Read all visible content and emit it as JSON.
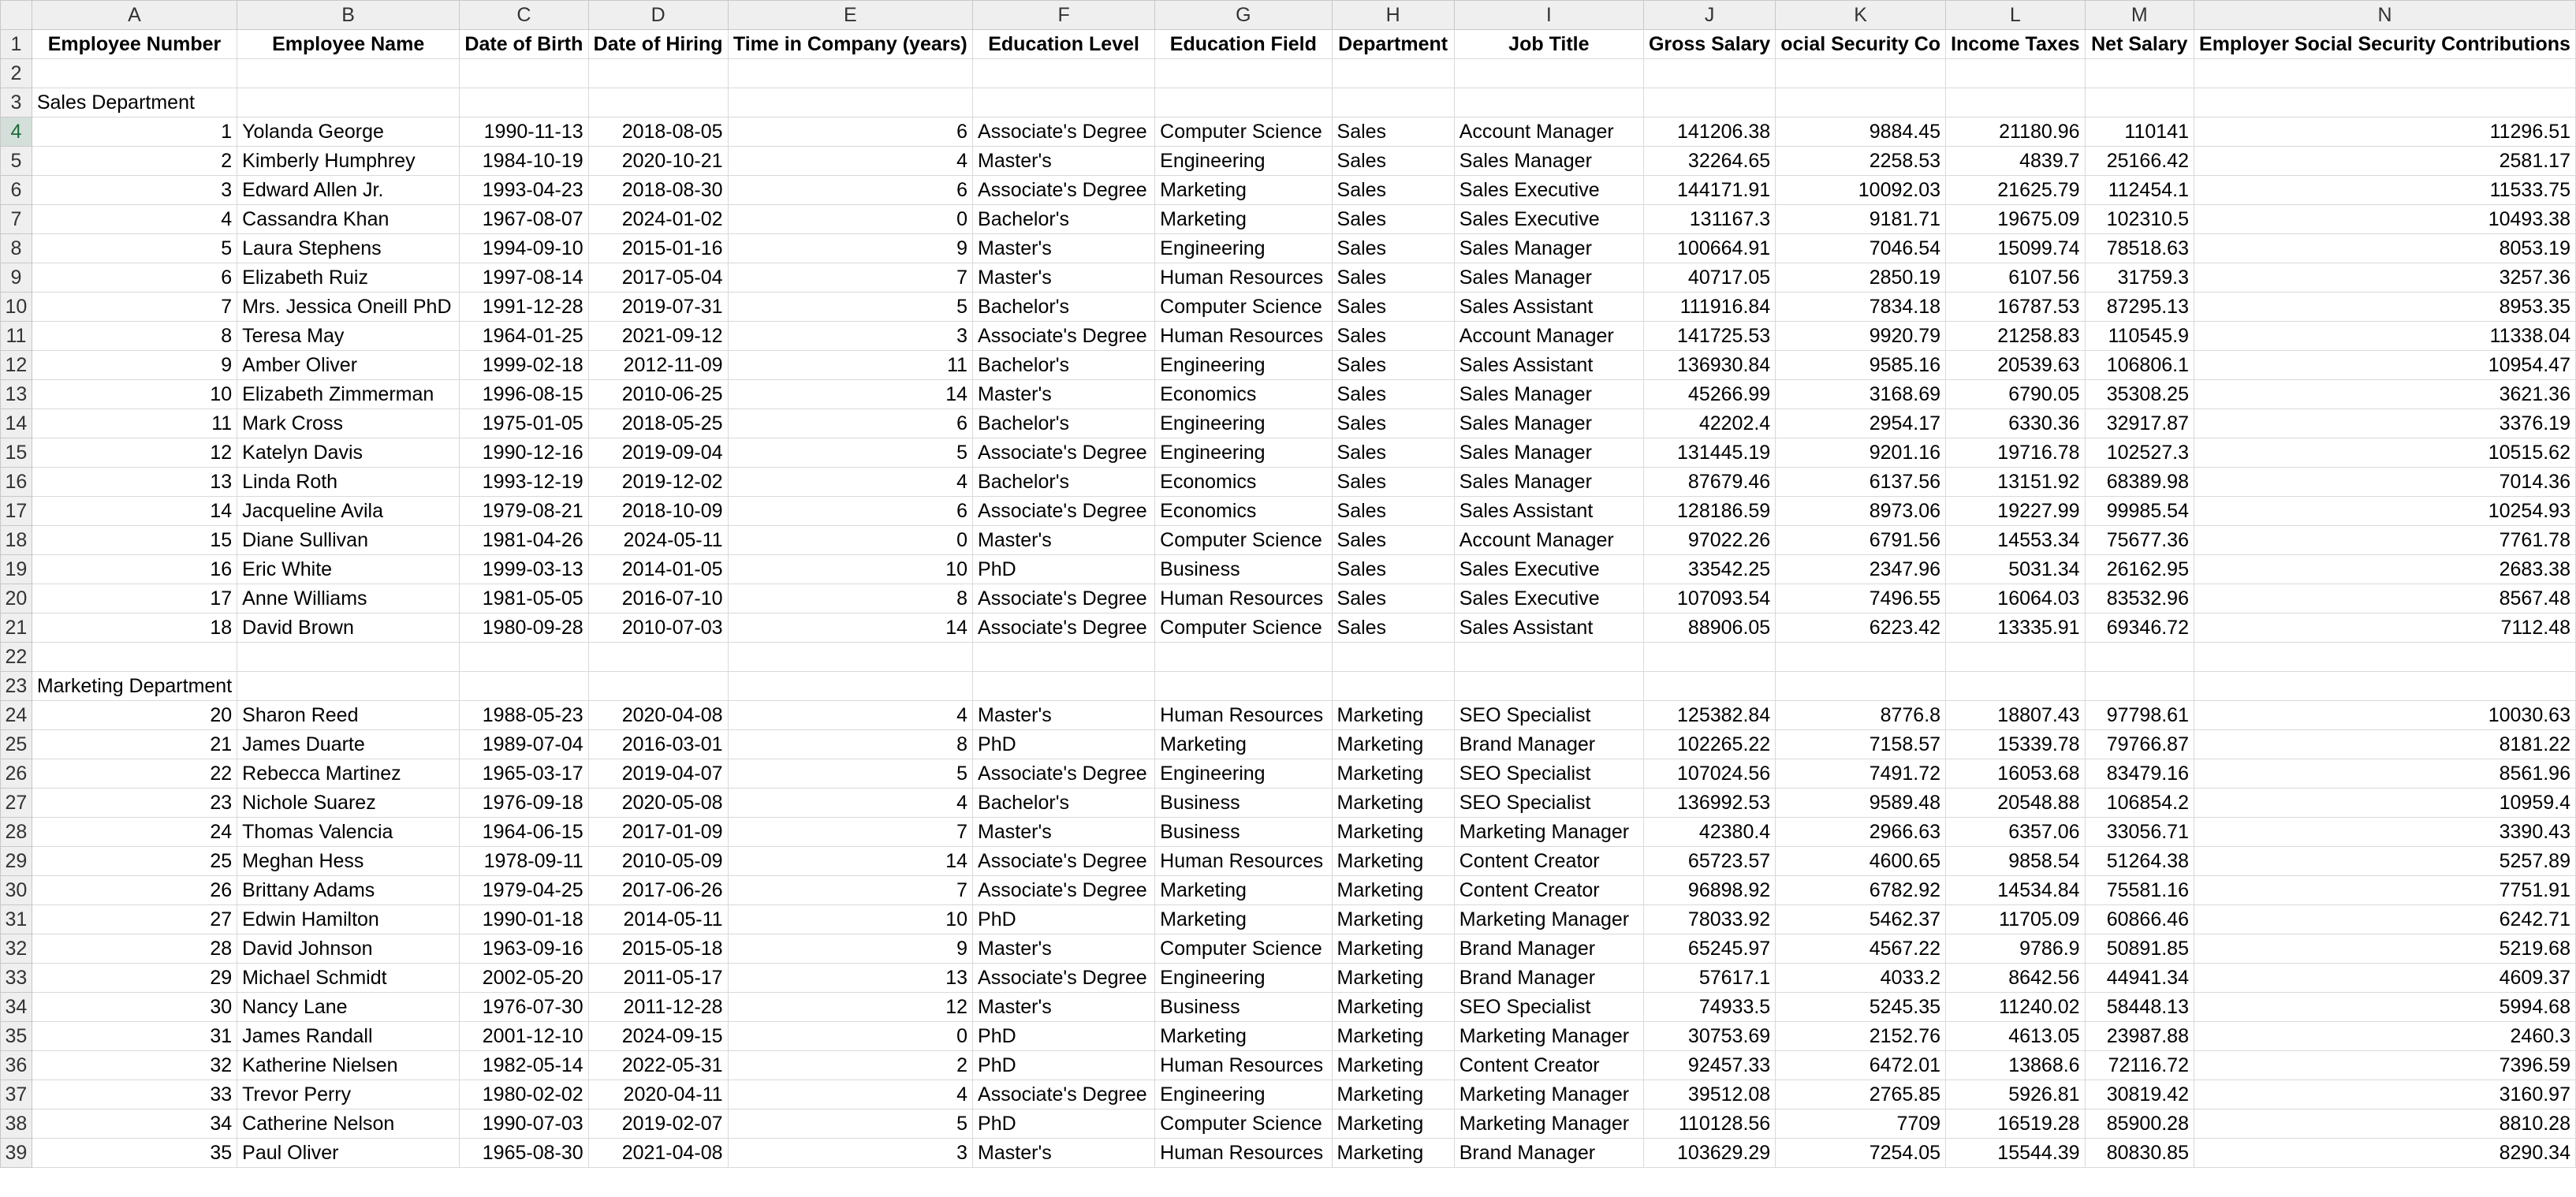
{
  "columns": [
    "A",
    "B",
    "C",
    "D",
    "E",
    "F",
    "G",
    "H",
    "I",
    "J",
    "K",
    "L",
    "M",
    "N"
  ],
  "headers": [
    "Employee Number",
    "Employee Name",
    "Date of Birth",
    "Date of Hiring",
    "Time in Company (years)",
    "Education Level",
    "Education Field",
    "Department",
    "Job Title",
    "Gross Salary",
    "ocial Security Co",
    "Income Taxes",
    "Net Salary",
    "Employer Social Security Contributions"
  ],
  "sections": {
    "sales": "Sales Department",
    "marketing": "Marketing Department"
  },
  "sales_rows": [
    [
      "1",
      "Yolanda George",
      "1990-11-13",
      "2018-08-05",
      "6",
      "Associate's Degree",
      "Computer Science",
      "Sales",
      "Account Manager",
      "141206.38",
      "9884.45",
      "21180.96",
      "110141",
      "11296.51"
    ],
    [
      "2",
      "Kimberly Humphrey",
      "1984-10-19",
      "2020-10-21",
      "4",
      "Master's",
      "Engineering",
      "Sales",
      "Sales Manager",
      "32264.65",
      "2258.53",
      "4839.7",
      "25166.42",
      "2581.17"
    ],
    [
      "3",
      "Edward Allen Jr.",
      "1993-04-23",
      "2018-08-30",
      "6",
      "Associate's Degree",
      "Marketing",
      "Sales",
      "Sales Executive",
      "144171.91",
      "10092.03",
      "21625.79",
      "112454.1",
      "11533.75"
    ],
    [
      "4",
      "Cassandra Khan",
      "1967-08-07",
      "2024-01-02",
      "0",
      "Bachelor's",
      "Marketing",
      "Sales",
      "Sales Executive",
      "131167.3",
      "9181.71",
      "19675.09",
      "102310.5",
      "10493.38"
    ],
    [
      "5",
      "Laura Stephens",
      "1994-09-10",
      "2015-01-16",
      "9",
      "Master's",
      "Engineering",
      "Sales",
      "Sales Manager",
      "100664.91",
      "7046.54",
      "15099.74",
      "78518.63",
      "8053.19"
    ],
    [
      "6",
      "Elizabeth Ruiz",
      "1997-08-14",
      "2017-05-04",
      "7",
      "Master's",
      "Human Resources",
      "Sales",
      "Sales Manager",
      "40717.05",
      "2850.19",
      "6107.56",
      "31759.3",
      "3257.36"
    ],
    [
      "7",
      "Mrs. Jessica Oneill PhD",
      "1991-12-28",
      "2019-07-31",
      "5",
      "Bachelor's",
      "Computer Science",
      "Sales",
      "Sales Assistant",
      "111916.84",
      "7834.18",
      "16787.53",
      "87295.13",
      "8953.35"
    ],
    [
      "8",
      "Teresa May",
      "1964-01-25",
      "2021-09-12",
      "3",
      "Associate's Degree",
      "Human Resources",
      "Sales",
      "Account Manager",
      "141725.53",
      "9920.79",
      "21258.83",
      "110545.9",
      "11338.04"
    ],
    [
      "9",
      "Amber Oliver",
      "1999-02-18",
      "2012-11-09",
      "11",
      "Bachelor's",
      "Engineering",
      "Sales",
      "Sales Assistant",
      "136930.84",
      "9585.16",
      "20539.63",
      "106806.1",
      "10954.47"
    ],
    [
      "10",
      "Elizabeth Zimmerman",
      "1996-08-15",
      "2010-06-25",
      "14",
      "Master's",
      "Economics",
      "Sales",
      "Sales Manager",
      "45266.99",
      "3168.69",
      "6790.05",
      "35308.25",
      "3621.36"
    ],
    [
      "11",
      "Mark Cross",
      "1975-01-05",
      "2018-05-25",
      "6",
      "Bachelor's",
      "Engineering",
      "Sales",
      "Sales Manager",
      "42202.4",
      "2954.17",
      "6330.36",
      "32917.87",
      "3376.19"
    ],
    [
      "12",
      "Katelyn Davis",
      "1990-12-16",
      "2019-09-04",
      "5",
      "Associate's Degree",
      "Engineering",
      "Sales",
      "Sales Manager",
      "131445.19",
      "9201.16",
      "19716.78",
      "102527.3",
      "10515.62"
    ],
    [
      "13",
      "Linda Roth",
      "1993-12-19",
      "2019-12-02",
      "4",
      "Bachelor's",
      "Economics",
      "Sales",
      "Sales Manager",
      "87679.46",
      "6137.56",
      "13151.92",
      "68389.98",
      "7014.36"
    ],
    [
      "14",
      "Jacqueline Avila",
      "1979-08-21",
      "2018-10-09",
      "6",
      "Associate's Degree",
      "Economics",
      "Sales",
      "Sales Assistant",
      "128186.59",
      "8973.06",
      "19227.99",
      "99985.54",
      "10254.93"
    ],
    [
      "15",
      "Diane Sullivan",
      "1981-04-26",
      "2024-05-11",
      "0",
      "Master's",
      "Computer Science",
      "Sales",
      "Account Manager",
      "97022.26",
      "6791.56",
      "14553.34",
      "75677.36",
      "7761.78"
    ],
    [
      "16",
      "Eric White",
      "1999-03-13",
      "2014-01-05",
      "10",
      "PhD",
      "Business",
      "Sales",
      "Sales Executive",
      "33542.25",
      "2347.96",
      "5031.34",
      "26162.95",
      "2683.38"
    ],
    [
      "17",
      "Anne Williams",
      "1981-05-05",
      "2016-07-10",
      "8",
      "Associate's Degree",
      "Human Resources",
      "Sales",
      "Sales Executive",
      "107093.54",
      "7496.55",
      "16064.03",
      "83532.96",
      "8567.48"
    ],
    [
      "18",
      "David Brown",
      "1980-09-28",
      "2010-07-03",
      "14",
      "Associate's Degree",
      "Computer Science",
      "Sales",
      "Sales Assistant",
      "88906.05",
      "6223.42",
      "13335.91",
      "69346.72",
      "7112.48"
    ]
  ],
  "marketing_rows": [
    [
      "20",
      "Sharon Reed",
      "1988-05-23",
      "2020-04-08",
      "4",
      "Master's",
      "Human Resources",
      "Marketing",
      "SEO Specialist",
      "125382.84",
      "8776.8",
      "18807.43",
      "97798.61",
      "10030.63"
    ],
    [
      "21",
      "James Duarte",
      "1989-07-04",
      "2016-03-01",
      "8",
      "PhD",
      "Marketing",
      "Marketing",
      "Brand Manager",
      "102265.22",
      "7158.57",
      "15339.78",
      "79766.87",
      "8181.22"
    ],
    [
      "22",
      "Rebecca Martinez",
      "1965-03-17",
      "2019-04-07",
      "5",
      "Associate's Degree",
      "Engineering",
      "Marketing",
      "SEO Specialist",
      "107024.56",
      "7491.72",
      "16053.68",
      "83479.16",
      "8561.96"
    ],
    [
      "23",
      "Nichole Suarez",
      "1976-09-18",
      "2020-05-08",
      "4",
      "Bachelor's",
      "Business",
      "Marketing",
      "SEO Specialist",
      "136992.53",
      "9589.48",
      "20548.88",
      "106854.2",
      "10959.4"
    ],
    [
      "24",
      "Thomas Valencia",
      "1964-06-15",
      "2017-01-09",
      "7",
      "Master's",
      "Business",
      "Marketing",
      "Marketing Manager",
      "42380.4",
      "2966.63",
      "6357.06",
      "33056.71",
      "3390.43"
    ],
    [
      "25",
      "Meghan Hess",
      "1978-09-11",
      "2010-05-09",
      "14",
      "Associate's Degree",
      "Human Resources",
      "Marketing",
      "Content Creator",
      "65723.57",
      "4600.65",
      "9858.54",
      "51264.38",
      "5257.89"
    ],
    [
      "26",
      "Brittany Adams",
      "1979-04-25",
      "2017-06-26",
      "7",
      "Associate's Degree",
      "Marketing",
      "Marketing",
      "Content Creator",
      "96898.92",
      "6782.92",
      "14534.84",
      "75581.16",
      "7751.91"
    ],
    [
      "27",
      "Edwin Hamilton",
      "1990-01-18",
      "2014-05-11",
      "10",
      "PhD",
      "Marketing",
      "Marketing",
      "Marketing Manager",
      "78033.92",
      "5462.37",
      "11705.09",
      "60866.46",
      "6242.71"
    ],
    [
      "28",
      "David Johnson",
      "1963-09-16",
      "2015-05-18",
      "9",
      "Master's",
      "Computer Science",
      "Marketing",
      "Brand Manager",
      "65245.97",
      "4567.22",
      "9786.9",
      "50891.85",
      "5219.68"
    ],
    [
      "29",
      "Michael Schmidt",
      "2002-05-20",
      "2011-05-17",
      "13",
      "Associate's Degree",
      "Engineering",
      "Marketing",
      "Brand Manager",
      "57617.1",
      "4033.2",
      "8642.56",
      "44941.34",
      "4609.37"
    ],
    [
      "30",
      "Nancy Lane",
      "1976-07-30",
      "2011-12-28",
      "12",
      "Master's",
      "Business",
      "Marketing",
      "SEO Specialist",
      "74933.5",
      "5245.35",
      "11240.02",
      "58448.13",
      "5994.68"
    ],
    [
      "31",
      "James Randall",
      "2001-12-10",
      "2024-09-15",
      "0",
      "PhD",
      "Marketing",
      "Marketing",
      "Marketing Manager",
      "30753.69",
      "2152.76",
      "4613.05",
      "23987.88",
      "2460.3"
    ],
    [
      "32",
      "Katherine Nielsen",
      "1982-05-14",
      "2022-05-31",
      "2",
      "PhD",
      "Human Resources",
      "Marketing",
      "Content Creator",
      "92457.33",
      "6472.01",
      "13868.6",
      "72116.72",
      "7396.59"
    ],
    [
      "33",
      "Trevor Perry",
      "1980-02-02",
      "2020-04-11",
      "4",
      "Associate's Degree",
      "Engineering",
      "Marketing",
      "Marketing Manager",
      "39512.08",
      "2765.85",
      "5926.81",
      "30819.42",
      "3160.97"
    ],
    [
      "34",
      "Catherine Nelson",
      "1990-07-03",
      "2019-02-07",
      "5",
      "PhD",
      "Computer Science",
      "Marketing",
      "Marketing Manager",
      "110128.56",
      "7709",
      "16519.28",
      "85900.28",
      "8810.28"
    ],
    [
      "35",
      "Paul Oliver",
      "1965-08-30",
      "2021-04-08",
      "3",
      "Master's",
      "Human Resources",
      "Marketing",
      "Brand Manager",
      "103629.29",
      "7254.05",
      "15544.39",
      "80830.85",
      "8290.34"
    ]
  ]
}
